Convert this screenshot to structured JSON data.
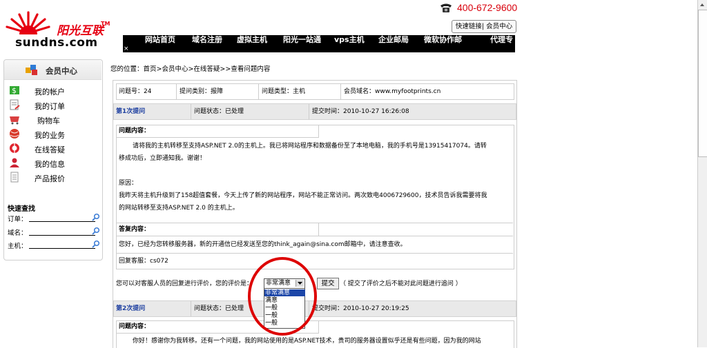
{
  "header": {
    "logo_cn": "阳光互联",
    "logo_tm": "TM",
    "logo_en": "sundns.com",
    "phone": "400-672-9600",
    "quick_link": "快速链接| 会员中心",
    "nav": [
      "网站首页",
      "域名注册",
      "虚拟主机",
      "阳光一站通",
      "vps主机",
      "企业邮局",
      "微软协作邮",
      "代理专"
    ],
    "nav_close": "×"
  },
  "sidebar": {
    "title": "会员中心",
    "items": [
      {
        "label": "我的帐户",
        "icon": "money-icon"
      },
      {
        "label": "我的订单",
        "icon": "order-icon"
      },
      {
        "label": "购物车",
        "icon": "cart-icon"
      },
      {
        "label": "我的业务",
        "icon": "globe-icon"
      },
      {
        "label": "在线答疑",
        "icon": "help-icon"
      },
      {
        "label": "我的信息",
        "icon": "user-icon"
      },
      {
        "label": "产品报价",
        "icon": "document-icon"
      }
    ],
    "quick_search": {
      "title": "快速查找",
      "fields": [
        "订单：",
        "域名：",
        "主机："
      ]
    }
  },
  "main": {
    "breadcrumb": "您的位置：首页>会员中心>在线答疑>>查看问题内容",
    "info": {
      "id": "问题号：24",
      "category": "提问类别：报障",
      "type": "问题类型：主机",
      "domain": "会员域名：www.myfootprints.cn"
    },
    "q1": {
      "label": "第1次提问",
      "status": "问题状态：已处理",
      "time": "提交时间：2010-10-27 16:26:08",
      "content_title": "问题内容：",
      "line1": "请将我的主机转移至支持ASP.NET 2.0的主机上。我已将网站程序和数据备份至了本地电脑，我的手机号是13915417074。请转",
      "line2": "移成功后，立即通知我。谢谢！",
      "line3": "原因：",
      "line4": "我昨天将主机升级到了158超值套餐，今天上传了新的网站程序，网站不能正常访问。两次致电4006729600，技术员告诉我需要将我",
      "line5": "的网站转移至支持ASP.NET 2.0 的主机上。",
      "reply_title": "答复内容：",
      "reply": "您好，已经为您转移服务器，新的开通信已经发送至您的think_again@sina.com邮箱中，请注意查收。",
      "agent": "回复客服：cs072"
    },
    "rating": {
      "prompt": "您可以对客服人员的回复进行评价，您的评价是：",
      "selected": "非常满意",
      "options": [
        "非常满意",
        "满意",
        "一般",
        "一般",
        "一般"
      ],
      "submit": "提交",
      "note": "（ 提交了评价之后不能对此问题进行追问 ）"
    },
    "q2": {
      "label": "第2次提问",
      "status": "问题状态：已处理",
      "time": "提交时间：2010-10-27 20:19:25",
      "content_title": "问题内容：",
      "line1": "你好！感谢你为我转移。还有一个问题，我的网站使用的是ASP.NET技术，贵司的服务器设置似乎还是有些问题，因为我的网站"
    }
  },
  "colors": {
    "brand_red": "#e60012",
    "nav_bg": "#000000",
    "highlight_ring": "#dd0000",
    "link_blue": "#1d3fa0",
    "select_blue": "#1c46a8"
  }
}
